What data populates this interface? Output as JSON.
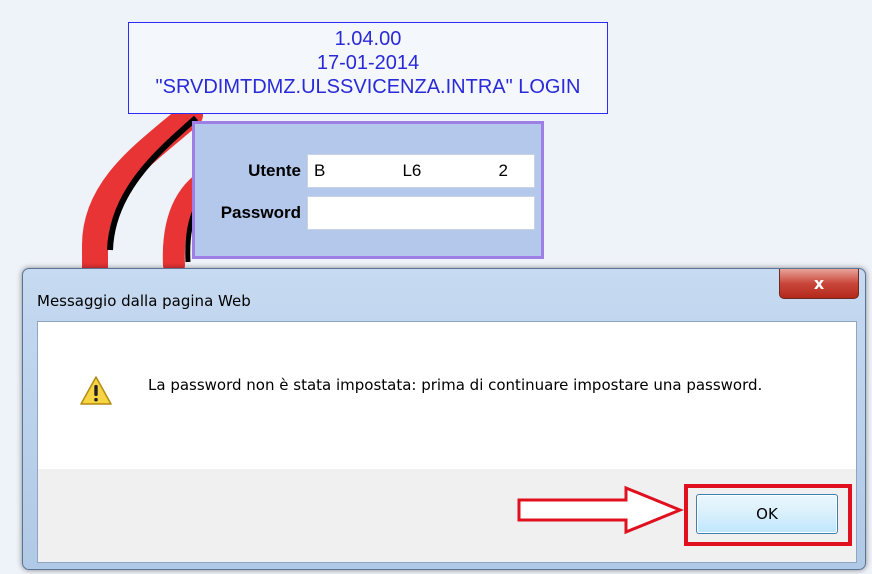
{
  "version_box": {
    "version": "1.04.00",
    "date": "17-01-2014",
    "server": "\"SRVDIMTDMZ.ULSSVICENZA.INTRA\" LOGIN"
  },
  "login": {
    "user_label": "Utente",
    "user_value_parts": [
      "B",
      "L6",
      "2"
    ],
    "password_label": "Password",
    "password_value": ""
  },
  "dialog": {
    "title": "Messaggio dalla pagina Web",
    "close_label": "x",
    "message": "La password non è stata impostata: prima di continuare impostare una password.",
    "ok_label": "OK",
    "icon": "warning-icon"
  },
  "colors": {
    "highlight": "#e0101e",
    "version_text": "#2a2ad8",
    "panel_bg": "#b3c8ea"
  }
}
